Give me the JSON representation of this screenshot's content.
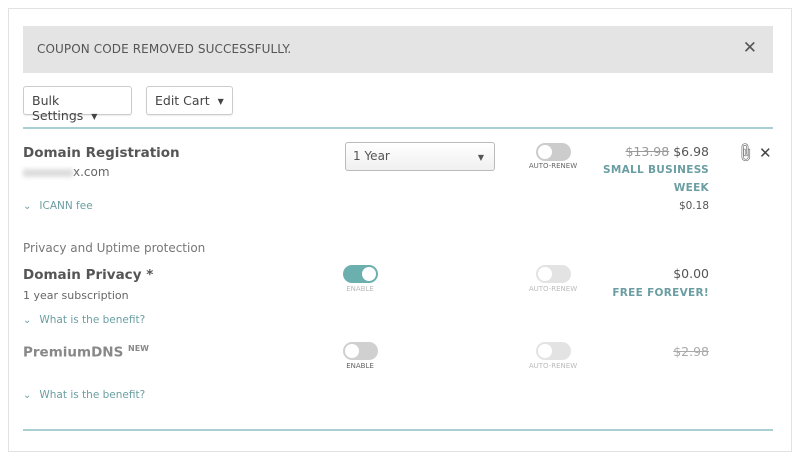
{
  "alert": {
    "message": "COUPON CODE REMOVED SUCCESSFULLY.",
    "close": "✕"
  },
  "toolbar": {
    "bulk_settings": "Bulk Settings",
    "edit_cart": "Edit Cart"
  },
  "domain_registration": {
    "title": "Domain Registration",
    "domain": "x.com",
    "period": "1 Year",
    "auto_renew_label": "AUTO-RENEW",
    "auto_renew": false,
    "original_price": "$13.98",
    "price": "$6.98",
    "promo_line1": "SMALL BUSINESS",
    "promo_line2": "WEEK",
    "icann_label": "ICANN fee",
    "icann_price": "$0.18"
  },
  "section_heading": "Privacy and Uptime protection",
  "domain_privacy": {
    "title": "Domain Privacy *",
    "subtitle": "1 year subscription",
    "enable_label": "ENABLE",
    "enabled": true,
    "auto_renew_label": "AUTO-RENEW",
    "price": "$0.00",
    "promo": "FREE FOREVER!",
    "benefit_link": "What is the benefit?"
  },
  "premium_dns": {
    "title": "PremiumDNS",
    "badge": "NEW",
    "enable_label": "ENABLE",
    "enabled": false,
    "auto_renew_label": "AUTO-RENEW",
    "price": "$2.98",
    "benefit_link": "What is the benefit?"
  }
}
